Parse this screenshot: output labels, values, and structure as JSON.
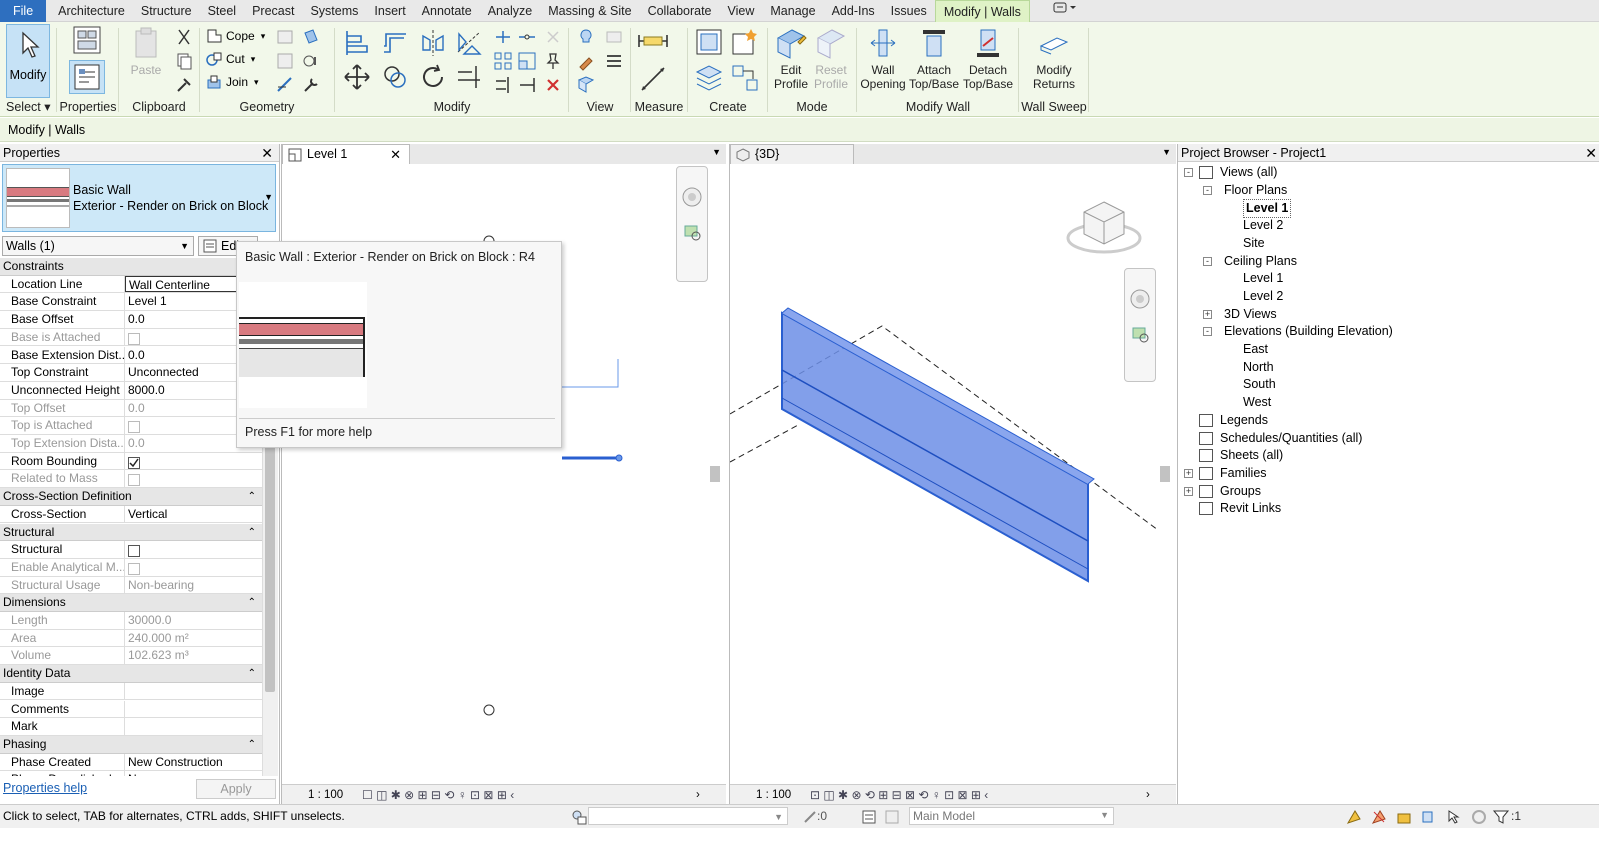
{
  "menu": {
    "tabs": [
      "File",
      "Architecture",
      "Structure",
      "Steel",
      "Precast",
      "Systems",
      "Insert",
      "Annotate",
      "Analyze",
      "Massing & Site",
      "Collaborate",
      "View",
      "Manage",
      "Add-Ins",
      "Issues",
      "Modify | Walls"
    ]
  },
  "ribbon": {
    "select": {
      "modify_label": "Modify",
      "group_label": "Select"
    },
    "properties": {
      "group_label": "Properties"
    },
    "clipboard": {
      "paste_label": "Paste",
      "group_label": "Clipboard"
    },
    "geometry": {
      "cope_label": "Cope",
      "cut_label": "Cut",
      "join_label": "Join",
      "group_label": "Geometry"
    },
    "modify": {
      "group_label": "Modify"
    },
    "view": {
      "group_label": "View"
    },
    "measure": {
      "group_label": "Measure"
    },
    "create": {
      "group_label": "Create"
    },
    "mode": {
      "edit_profile": "Edit Profile",
      "reset_profile": "Reset Profile",
      "group_label": "Mode"
    },
    "modify_wall": {
      "wall_opening": "Wall Opening",
      "attach": "Attach Top/Base",
      "detach": "Detach Top/Base",
      "group_label": "Modify Wall"
    },
    "wall_sweep": {
      "modify_returns": "Modify Returns",
      "group_label": "Wall Sweep"
    }
  },
  "context_bar": {
    "title": "Modify | Walls"
  },
  "properties": {
    "title": "Properties",
    "family": "Basic Wall",
    "type": "Exterior - Render on Brick on Block",
    "filter": "Walls (1)",
    "edit_type": "Edit T",
    "sections": [
      {
        "name": "Constraints",
        "rows": [
          {
            "k": "Location Line",
            "v": "Wall Centerline",
            "dis": false
          },
          {
            "k": "Base Constraint",
            "v": "Level 1",
            "dis": false
          },
          {
            "k": "Base Offset",
            "v": "0.0",
            "dis": false
          },
          {
            "k": "Base is Attached",
            "v": "",
            "cb": "empty",
            "dis": true
          },
          {
            "k": "Base Extension Dist...",
            "v": "0.0",
            "dis": false
          },
          {
            "k": "Top Constraint",
            "v": "Unconnected",
            "dis": false
          },
          {
            "k": "Unconnected Height",
            "v": "8000.0",
            "dis": false
          },
          {
            "k": "Top Offset",
            "v": "0.0",
            "dis": true
          },
          {
            "k": "Top is Attached",
            "v": "",
            "cb": "empty",
            "dis": true
          },
          {
            "k": "Top Extension Dista...",
            "v": "0.0",
            "dis": true
          },
          {
            "k": "Room Bounding",
            "v": "",
            "cb": "checked",
            "dis": false
          },
          {
            "k": "Related to Mass",
            "v": "",
            "cb": "empty",
            "dis": true
          }
        ]
      },
      {
        "name": "Cross-Section Definition",
        "rows": [
          {
            "k": "Cross-Section",
            "v": "Vertical",
            "dis": false
          }
        ]
      },
      {
        "name": "Structural",
        "rows": [
          {
            "k": "Structural",
            "v": "",
            "cb": "empty",
            "dis": false
          },
          {
            "k": "Enable Analytical M...",
            "v": "",
            "cb": "empty",
            "dis": true
          },
          {
            "k": "Structural Usage",
            "v": "Non-bearing",
            "dis": true
          }
        ]
      },
      {
        "name": "Dimensions",
        "rows": [
          {
            "k": "Length",
            "v": "30000.0",
            "dis": true
          },
          {
            "k": "Area",
            "v": "240.000 m²",
            "dis": true
          },
          {
            "k": "Volume",
            "v": "102.623 m³",
            "dis": true
          }
        ]
      },
      {
        "name": "Identity Data",
        "rows": [
          {
            "k": "Image",
            "v": "",
            "dis": false
          },
          {
            "k": "Comments",
            "v": "",
            "dis": false
          },
          {
            "k": "Mark",
            "v": "",
            "dis": false
          }
        ]
      },
      {
        "name": "Phasing",
        "rows": [
          {
            "k": "Phase Created",
            "v": "New Construction",
            "dis": false
          },
          {
            "k": "Phase Demolished",
            "v": "None",
            "dis": false
          }
        ]
      }
    ],
    "help_link": "Properties help",
    "apply": "Apply"
  },
  "view1": {
    "tab": "Level 1",
    "scale": "1 : 100"
  },
  "view2": {
    "tab": "{3D}",
    "scale": "1 : 100"
  },
  "tooltip": {
    "title": "Basic Wall : Exterior - Render on Brick on Block : R4",
    "help": "Press F1 for more help"
  },
  "browser": {
    "title": "Project Browser - Project1",
    "nodes": [
      {
        "t": "Views (all)",
        "lvl": 0,
        "tog": "-",
        "icon": true
      },
      {
        "t": "Floor Plans",
        "lvl": 1,
        "tog": "-"
      },
      {
        "t": "Level 1",
        "lvl": 2,
        "sel": true
      },
      {
        "t": "Level 2",
        "lvl": 2
      },
      {
        "t": "Site",
        "lvl": 2
      },
      {
        "t": "Ceiling Plans",
        "lvl": 1,
        "tog": "-"
      },
      {
        "t": "Level 1",
        "lvl": 2
      },
      {
        "t": "Level 2",
        "lvl": 2
      },
      {
        "t": "3D Views",
        "lvl": 1,
        "tog": "+"
      },
      {
        "t": "Elevations (Building Elevation)",
        "lvl": 1,
        "tog": "-"
      },
      {
        "t": "East",
        "lvl": 2
      },
      {
        "t": "North",
        "lvl": 2
      },
      {
        "t": "South",
        "lvl": 2
      },
      {
        "t": "West",
        "lvl": 2
      },
      {
        "t": "Legends",
        "lvl": 0,
        "icon": true
      },
      {
        "t": "Schedules/Quantities (all)",
        "lvl": 0,
        "icon": true
      },
      {
        "t": "Sheets (all)",
        "lvl": 0,
        "icon": true
      },
      {
        "t": "Families",
        "lvl": 0,
        "tog": "+",
        "icon": true
      },
      {
        "t": "Groups",
        "lvl": 0,
        "tog": "+",
        "icon": true
      },
      {
        "t": "Revit Links",
        "lvl": 0,
        "icon": true
      }
    ]
  },
  "status": {
    "message": "Click to select, TAB for alternates, CTRL adds, SHIFT unselects.",
    "count": ":0",
    "model": "Main Model",
    "filter_count": ":1"
  },
  "colors": {
    "accent": "#2e6fbf",
    "ribbon_bg": "#f2f8ea",
    "wall_fill": "#5b82e0",
    "render_layer": "#d87a80"
  }
}
